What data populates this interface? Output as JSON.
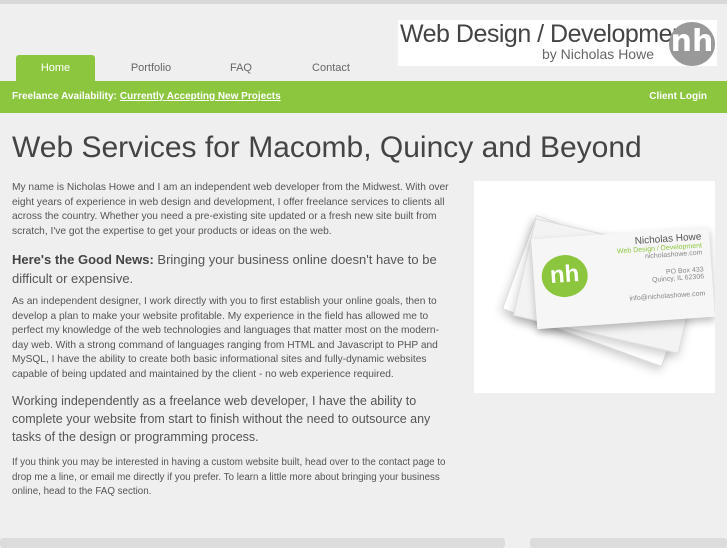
{
  "logo": {
    "line1": "Web Design / Development",
    "line2": "by Nicholas Howe",
    "mark": "nh"
  },
  "nav": {
    "tabs": [
      {
        "label": "Home"
      },
      {
        "label": "Portfolio"
      },
      {
        "label": "FAQ"
      },
      {
        "label": "Contact"
      }
    ]
  },
  "bar": {
    "availability_label": "Freelance Availability:",
    "availability_link": "Currently Accepting New Projects",
    "client_login": "Client Login"
  },
  "main": {
    "title": "Web Services for Macomb, Quincy and Beyond",
    "intro": "My name is Nicholas Howe and I am an independent web developer from the Midwest. With over eight years of experience in web design and development, I offer freelance services to clients all across the country. Whether you need a pre-existing site updated or a fresh new site built from scratch, I've got the expertise to get your products or ideas on the web.",
    "news_label": "Here's the Good News:",
    "news_text": " Bringing your business online doesn't have to be difficult or expensive.",
    "para2": "As an independent designer, I work directly with you to first establish your online goals, then to develop a plan to make your website profitable. My experience in the field has allowed me to perfect my knowledge of the web technologies and languages that matter most on the modern-day web. With a strong command of languages ranging from HTML and Javascript to PHP and MySQL, I have the ability to create both basic informational sites and fully-dynamic websites capable of being updated and maintained by the client - no web experience required.",
    "para3": "Working independently as a freelance web developer, I have the ability to complete your website from start to finish without the need to outsource any tasks of the design or programming process.",
    "para4": "If you think you may be interested in having a custom website built, head over to the contact page to drop me a line, or email me directly if you prefer. To learn a little more about bringing your business online, head to the FAQ section."
  },
  "card": {
    "name": "Nicholas Howe",
    "title": "Web Design / Development",
    "site": "nicholashowe.com",
    "address1": "PO Box 433",
    "address2": "Quincy, IL 62306",
    "email": "info@nicholashowe.com",
    "mark": "nh"
  },
  "colors": {
    "accent": "#8cc63f",
    "background": "#efefef",
    "text": "#555555"
  }
}
